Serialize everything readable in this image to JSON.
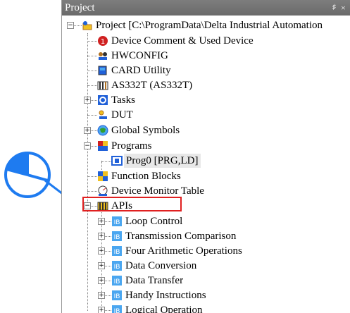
{
  "panel": {
    "title": "Project",
    "pin_glyph": "♯",
    "close_glyph": "×"
  },
  "tree": {
    "root": {
      "label": "Project [C:\\ProgramData\\Delta Industrial Automation",
      "icon": "project-icon",
      "expander": "−"
    },
    "items": [
      {
        "id": "device-comment",
        "label": "Device Comment & Used Device",
        "icon": "device-comment-icon"
      },
      {
        "id": "hwconfig",
        "label": "HWCONFIG",
        "icon": "hwconfig-icon"
      },
      {
        "id": "card-utility",
        "label": "CARD Utility",
        "icon": "card-utility-icon"
      },
      {
        "id": "as332t",
        "label": "AS332T  (AS332T)",
        "icon": "plc-icon"
      },
      {
        "id": "tasks",
        "label": "Tasks",
        "icon": "tasks-icon",
        "expander": "+"
      },
      {
        "id": "dut",
        "label": "DUT",
        "icon": "dut-icon"
      },
      {
        "id": "global-symbols",
        "label": "Global Symbols",
        "icon": "global-symbols-icon",
        "expander": "+"
      },
      {
        "id": "programs",
        "label": "Programs",
        "icon": "programs-icon",
        "expander": "−"
      },
      {
        "id": "prog0",
        "label": "Prog0 [PRG,LD]",
        "icon": "program-file-icon"
      },
      {
        "id": "function-blocks",
        "label": "Function Blocks",
        "icon": "function-blocks-icon"
      },
      {
        "id": "device-monitor",
        "label": "Device Monitor Table",
        "icon": "device-monitor-icon"
      },
      {
        "id": "apis",
        "label": "APIs",
        "icon": "apis-icon",
        "expander": "−"
      },
      {
        "id": "loop-control",
        "label": "Loop Control",
        "icon": "api-category-icon",
        "expander": "+"
      },
      {
        "id": "transmission-comparison",
        "label": "Transmission Comparison",
        "icon": "api-category-icon",
        "expander": "+"
      },
      {
        "id": "four-arithmetic",
        "label": "Four Arithmetic Operations",
        "icon": "api-category-icon",
        "expander": "+"
      },
      {
        "id": "data-conversion",
        "label": "Data Conversion",
        "icon": "api-category-icon",
        "expander": "+"
      },
      {
        "id": "data-transfer",
        "label": "Data Transfer",
        "icon": "api-category-icon",
        "expander": "+"
      },
      {
        "id": "handy-instructions",
        "label": "Handy Instructions",
        "icon": "api-category-icon",
        "expander": "+"
      },
      {
        "id": "logical-operation",
        "label": "Logical Operation",
        "icon": "api-category-icon",
        "expander": "+"
      }
    ]
  },
  "annotation": {
    "highlight_color": "#e02020",
    "pointer_color": "#1e7bf0",
    "pie_fill": "#1e7bf0",
    "pie_outline": "#1e7bf0"
  },
  "icon_colors": {
    "blue": "#2060d8",
    "light_blue": "#4aa6f0",
    "red": "#d02020",
    "yellow": "#f0c020",
    "green": "#30a030",
    "dark": "#303030",
    "brown": "#b07020"
  }
}
